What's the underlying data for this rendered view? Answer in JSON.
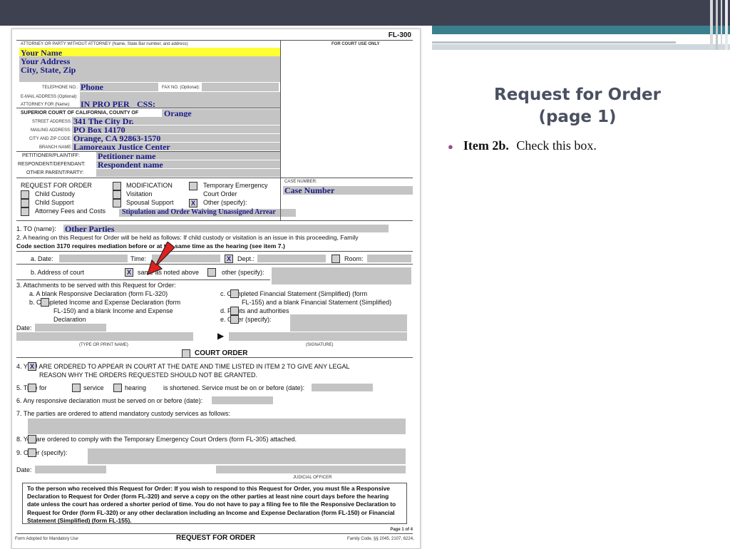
{
  "slide": {
    "title_line1": "Request for Order",
    "title_line2": "(page 1)",
    "bullet_strong": "Item 2b.",
    "bullet_text": "Check this box.",
    "colors": {
      "topbar": "#3e4150",
      "accent": "#3a7f8e",
      "title": "#4a5060",
      "bullet_dot": "#9a4a8c",
      "arrow": "#e02020"
    }
  },
  "form": {
    "form_id": "FL-300",
    "attorney_header": "ATTORNEY OR PARTY WITHOUT ATTORNEY (Name, State Bar number, and address)",
    "court_use": "FOR COURT USE ONLY",
    "your_name": "Your Name",
    "your_address": "Your Address",
    "city_state_zip": "City, State, Zip",
    "telephone_label": "TELEPHONE NO.:",
    "telephone_value": "Phone",
    "fax_label": "FAX NO. (Optional):",
    "email_label": "E-MAIL ADDRESS (Optional):",
    "attorney_for_label": "ATTORNEY FOR (Name):",
    "attorney_for_value": "IN PRO PER",
    "css_label": "CSS:",
    "court_label": "SUPERIOR COURT OF CALIFORNIA, COUNTY OF",
    "county_value": "Orange",
    "street_label": "STREET ADDRESS:",
    "street_value": "341 The City Dr.",
    "mailing_label": "MAILING ADDRESS:",
    "mailing_value": "PO Box 14170",
    "cityzip_label": "CITY AND ZIP CODE:",
    "cityzip_value": "Orange, CA  92863-1570",
    "branch_label": "BRANCH NAME:",
    "branch_value": "Lamoreaux Justice Center",
    "petitioner_label": "PETITIONER/PLAINTIFF:",
    "petitioner_value": "Petitioner name",
    "respondent_label": "RESPONDENT/DEFENDANT:",
    "respondent_value": "Respondent name",
    "other_parent_label": "OTHER PARENT/PARTY:",
    "rfo_label": "REQUEST FOR ORDER",
    "modification": "MODIFICATION",
    "temp_emergency": "Temporary Emergency",
    "court_order": "Court Order",
    "child_custody": "Child Custody",
    "visitation": "Visitation",
    "child_support": "Child Support",
    "spousal_support": "Spousal Support",
    "other_specify": "Other (specify):",
    "attorney_fees": "Attorney Fees and Costs",
    "stipulation": "Stipulation and Order Waiving Unassigned Arrear",
    "case_number_label": "CASE NUMBER:",
    "case_number_value": "Case Number",
    "item1": "1.   TO (name):",
    "item1_value": "Other Parties",
    "item2_line1": "2.   A hearing on this Request for Order will be held as follows: If child custody or visitation is an issue in this proceeding, Family",
    "item2_line2": "Code section 3170 requires mediation before or at the same time as the hearing (see item 7.)",
    "item2a_date": "a.  Date:",
    "item2a_time": "Time:",
    "item2a_dept": "Dept.:",
    "item2a_room": "Room:",
    "item2b": "b.  Address of court",
    "same_as_noted": "same as noted above",
    "other_specify2": "other (specify):",
    "item3": "3.   Attachments to be served with this Request for Order:",
    "item3a": "a.   A blank Responsive Declaration (form FL-320)",
    "item3b1": "b.         Completed Income and Expense Declaration (form",
    "item3b2": "FL-150) and a blank Income and Expense",
    "item3b3": "Declaration",
    "item3c1": "c.         Completed Financial Statement (Simplified) (form",
    "item3c2": "FL-155) and a blank Financial Statement (Simplified)",
    "item3d": "d.         Points and authorities",
    "item3e": "e.         Other (specify):",
    "date_label": "Date:",
    "type_print": "(TYPE OR PRINT NAME)",
    "signature": "(SIGNATURE)",
    "court_order_head": "COURT ORDER",
    "item4_line1": "4.        YOU ARE ORDERED TO APPEAR IN COURT AT THE DATE AND TIME LISTED IN ITEM 2 TO GIVE ANY LEGAL",
    "item4_line2": "REASON WHY THE ORDERS REQUESTED SHOULD NOT BE GRANTED.",
    "item5_a": "5.        Time for",
    "item5_b": "service",
    "item5_c": "hearing",
    "item5_d": "is shortened. Service must be on or before (date):",
    "item6": "6.   Any responsive declaration must be served on or before (date):",
    "item7": "7.   The parties are ordered to attend mandatory custody services as follows:",
    "item8": "8.        You are ordered to comply with the Temporary Emergency Court Orders (form FL-305) attached.",
    "item9": "9.        Other (specify):",
    "judicial_officer": "JUDICIAL OFFICER",
    "notice": "To the person who received this Request for Order: If you wish to respond to this Request for Order, you must file a Responsive Declaration to Request for Order (form FL-320) and serve a copy on the other parties at least nine court days before the hearing date unless the court has ordered a shorter period of time. You do not have to pay a filing fee to file the Responsive Declaration to Request for Order (form FL-320) or any other declaration including an Income and Expense Declaration (form FL-150) or Financial Statement (Simplified) (form FL-155).",
    "page_of": "Page 1 of 4",
    "footer_left": "Form Adopted for Mandatory Use",
    "footer_center": "REQUEST FOR ORDER",
    "footer_right": "Family Code, §§ 2045, 2107, 6224,",
    "check_x": "X"
  }
}
